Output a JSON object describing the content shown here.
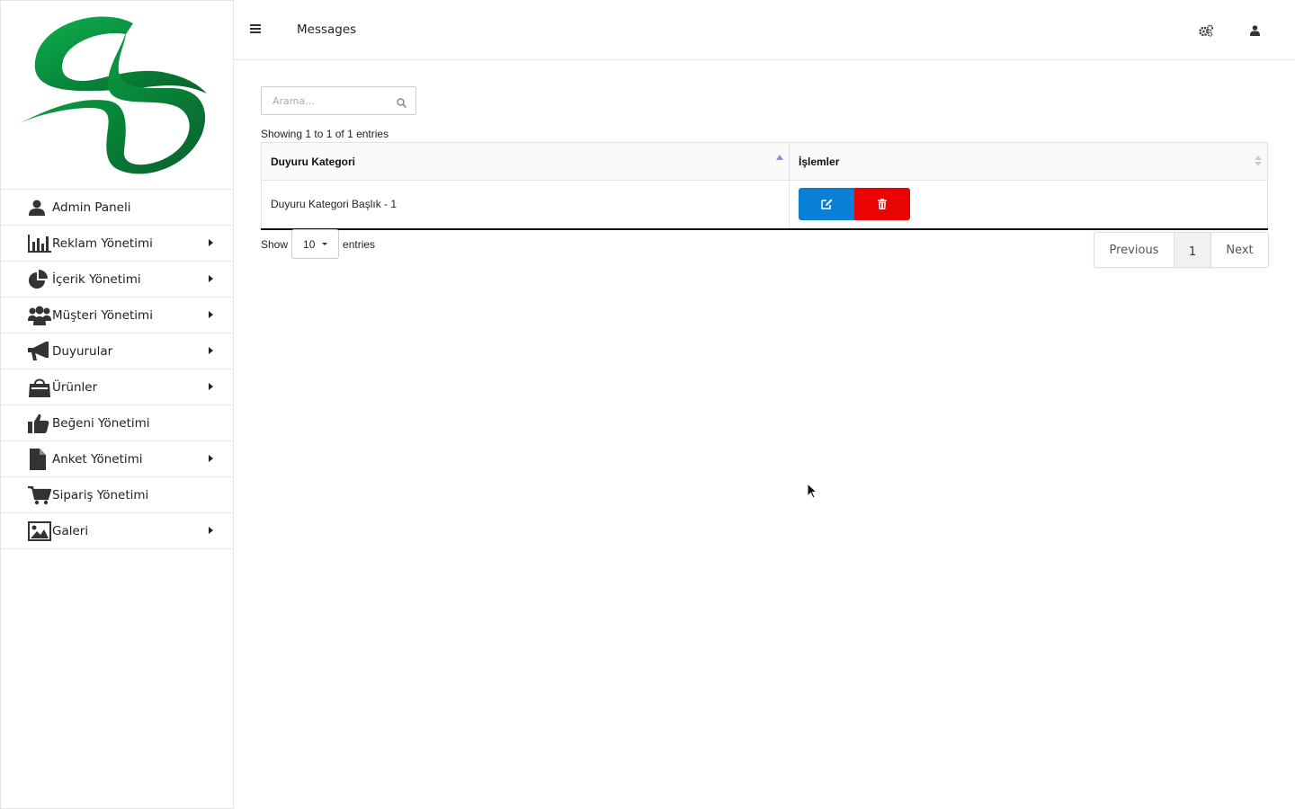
{
  "topbar": {
    "title": "Messages",
    "icons": [
      "hamburger-icon",
      "cogs-icon",
      "user-icon"
    ]
  },
  "sidebar": {
    "logo": "green-s-logo",
    "items": [
      {
        "label": "Admin Paneli",
        "icon": "user-icon",
        "has_submenu": false
      },
      {
        "label": "Reklam Yönetimi",
        "icon": "bar-chart-icon",
        "has_submenu": true
      },
      {
        "label": "İçerik Yönetimi",
        "icon": "pie-chart-icon",
        "has_submenu": true
      },
      {
        "label": "Müşteri Yönetimi",
        "icon": "users-icon",
        "has_submenu": true
      },
      {
        "label": "Duyurular",
        "icon": "bullhorn-icon",
        "has_submenu": true
      },
      {
        "label": "Ürünler",
        "icon": "shopping-bag-icon",
        "has_submenu": true
      },
      {
        "label": "Beğeni Yönetimi",
        "icon": "thumbs-up-icon",
        "has_submenu": false
      },
      {
        "label": "Anket Yönetimi",
        "icon": "file-icon",
        "has_submenu": true
      },
      {
        "label": "Sipariş Yönetimi",
        "icon": "cart-icon",
        "has_submenu": false
      },
      {
        "label": "Galeri",
        "icon": "image-icon",
        "has_submenu": true
      }
    ]
  },
  "search": {
    "placeholder": "Arama..."
  },
  "table": {
    "info": "Showing 1 to 1 of 1 entries",
    "columns": [
      "Duyuru Kategori",
      "İşlemler"
    ],
    "rows": [
      {
        "kategori": "Duyuru Kategori Başlık - 1"
      }
    ],
    "colors": {
      "edit": "#0a7fd8",
      "delete": "#ea0505"
    }
  },
  "length": {
    "show_label": "Show",
    "value": "10",
    "entries_label": "entries"
  },
  "pagination": {
    "previous": "Previous",
    "current": "1",
    "next": "Next"
  }
}
